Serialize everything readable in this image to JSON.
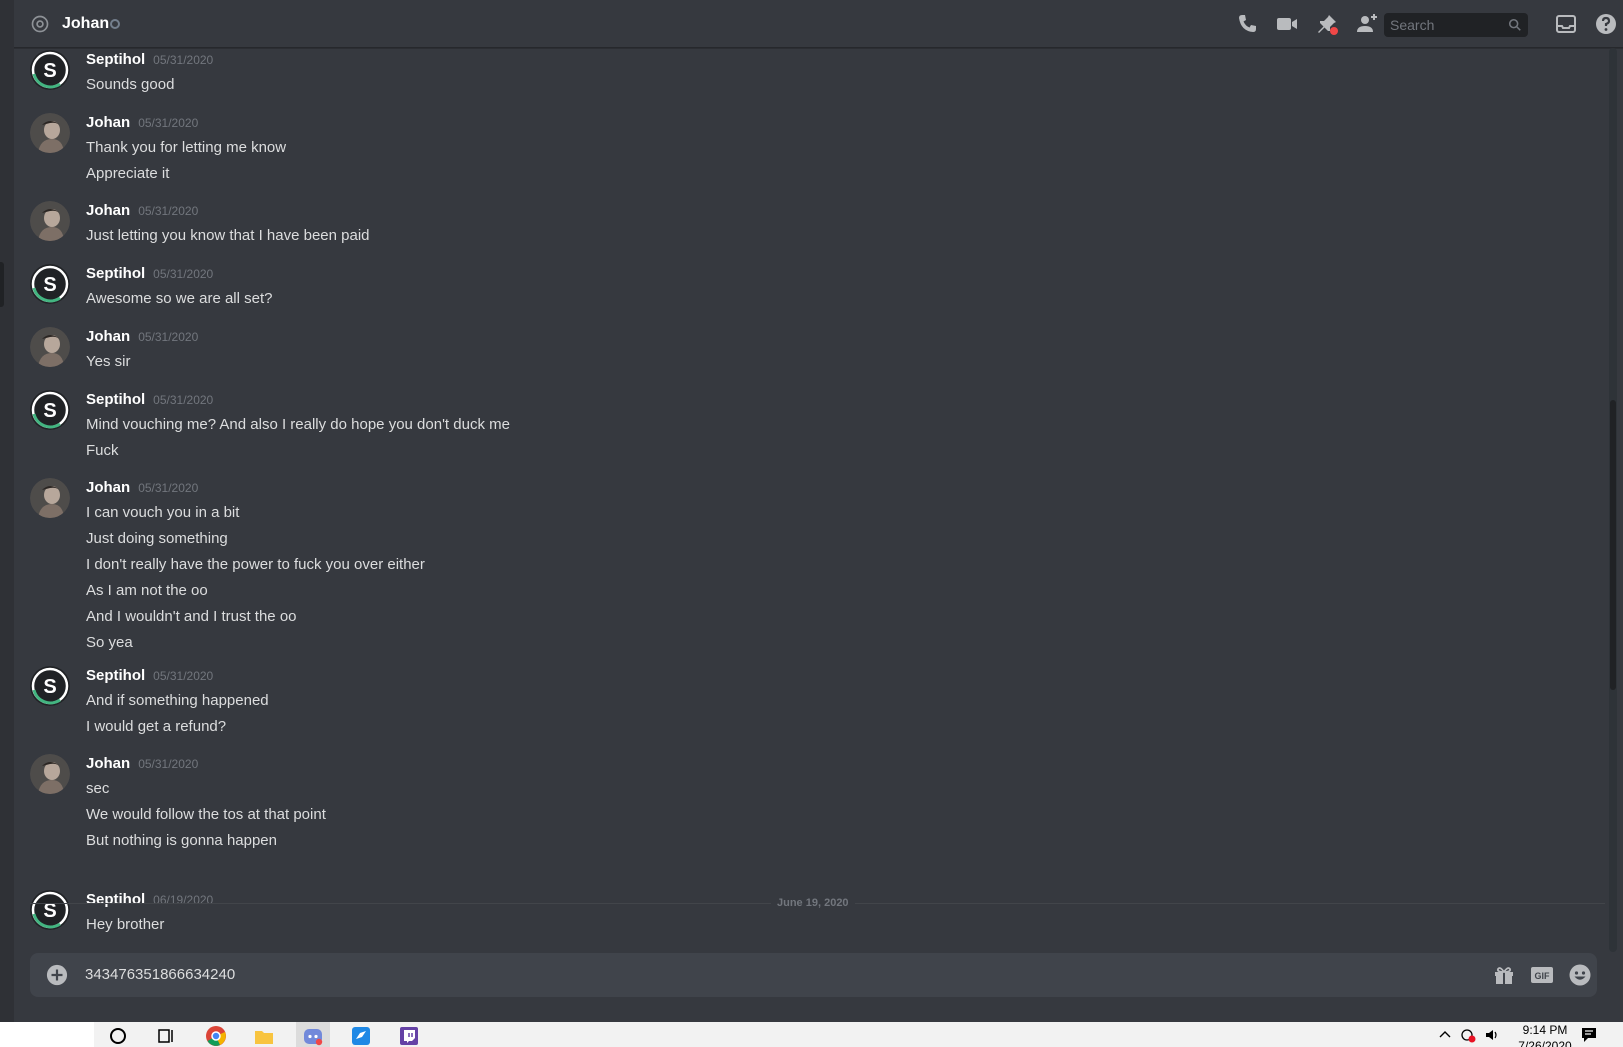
{
  "header": {
    "title": "Johan",
    "search_placeholder": "Search"
  },
  "messages": [
    {
      "author": "Septihol",
      "timestamp": "05/31/2020",
      "avatar": "septihol-avatar",
      "lines": [
        "Sounds good"
      ]
    },
    {
      "author": "Johan",
      "timestamp": "05/31/2020",
      "avatar": "johan-avatar",
      "lines": [
        "Thank you for letting me know",
        "Appreciate it"
      ]
    },
    {
      "author": "Johan",
      "timestamp": "05/31/2020",
      "avatar": "johan-avatar",
      "lines": [
        "Just letting you know that I have been paid"
      ]
    },
    {
      "author": "Septihol",
      "timestamp": "05/31/2020",
      "avatar": "septihol-avatar",
      "lines": [
        "Awesome so we are all set?"
      ]
    },
    {
      "author": "Johan",
      "timestamp": "05/31/2020",
      "avatar": "johan-avatar",
      "lines": [
        "Yes sir"
      ]
    },
    {
      "author": "Septihol",
      "timestamp": "05/31/2020",
      "avatar": "septihol-avatar",
      "lines": [
        "Mind vouching me? And also I really do hope you don't duck me",
        "Fuck"
      ]
    },
    {
      "author": "Johan",
      "timestamp": "05/31/2020",
      "avatar": "johan-avatar",
      "lines": [
        "I can vouch you in a bit",
        "Just doing something",
        "I don't really have the power to fuck you over either",
        "As I am not the oo",
        "And I wouldn't and I trust the oo",
        "So yea"
      ]
    },
    {
      "author": "Septihol",
      "timestamp": "05/31/2020",
      "avatar": "septihol-avatar",
      "lines": [
        "And if something happened",
        "I would get a refund?"
      ]
    },
    {
      "author": "Johan",
      "timestamp": "05/31/2020",
      "avatar": "johan-avatar",
      "lines": [
        "sec",
        "We would follow the tos at that point",
        "But nothing is gonna happen"
      ]
    },
    {
      "author": "Septihol",
      "timestamp": "06/19/2020",
      "avatar": "septihol-avatar",
      "lines": [
        "Hey brother"
      ]
    }
  ],
  "date_divider": "June 19, 2020",
  "composer": {
    "value": "343476351866634240",
    "gif_label": "GIF"
  },
  "taskbar": {
    "time": "9:14 PM",
    "date": "7/26/2020"
  },
  "colors": {
    "background": "#36393f",
    "septihol_accent": "#43b581",
    "header_text": "#ffffff"
  }
}
